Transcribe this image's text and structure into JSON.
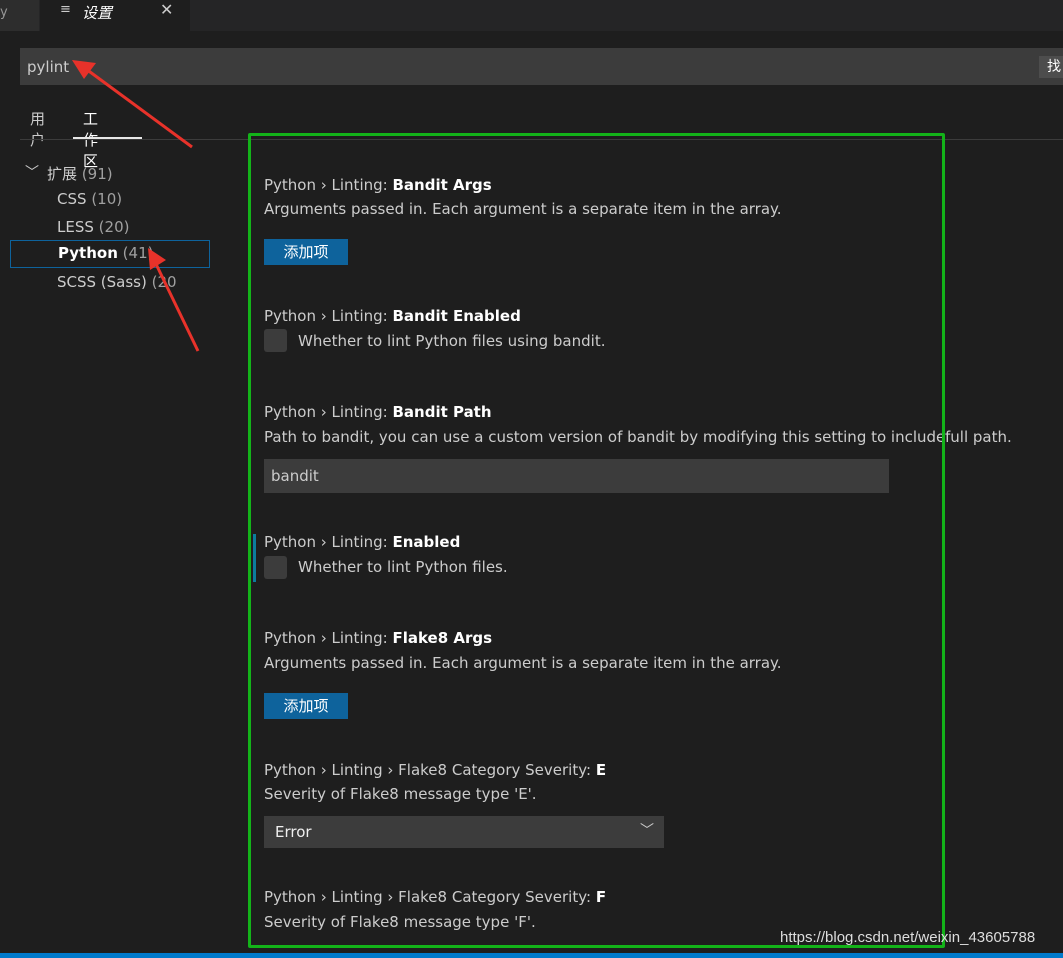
{
  "tabs": {
    "prev_label": "y",
    "active_icon": "settings-file-icon",
    "active_title": "设置",
    "close_glyph": "✕"
  },
  "search": {
    "value": "pylint",
    "badge": "找"
  },
  "scope_tabs": {
    "user": "用户",
    "workspace": "工作区"
  },
  "toc": {
    "group_label": "扩展",
    "group_count": "(91)",
    "items": [
      {
        "label": "CSS",
        "count": "(10)"
      },
      {
        "label": "LESS",
        "count": "(20)"
      },
      {
        "label": "Python",
        "count": "(41)"
      },
      {
        "label": "SCSS (Sass)",
        "count": "(20"
      }
    ]
  },
  "settings": [
    {
      "prefix": "Python › Linting: ",
      "name": "Bandit Args",
      "desc": "Arguments passed in. Each argument is a separate item in the array.",
      "button": "添加项"
    },
    {
      "prefix": "Python › Linting: ",
      "name": "Bandit Enabled",
      "desc": "Whether to lint Python files using bandit."
    },
    {
      "prefix": "Python › Linting: ",
      "name": "Bandit Path",
      "desc": "Path to bandit, you can use a custom version of bandit by modifying this setting to include the",
      "value": "bandit"
    },
    {
      "prefix": "Python › Linting: ",
      "name": "Enabled",
      "desc": "Whether to lint Python files."
    },
    {
      "prefix": "Python › Linting: ",
      "name": "Flake8 Args",
      "desc": "Arguments passed in. Each argument is a separate item in the array.",
      "button": "添加项"
    },
    {
      "prefix": "Python › Linting › Flake8 Category Severity: ",
      "name": "E",
      "desc": "Severity of Flake8 message type 'E'.",
      "value": "Error"
    },
    {
      "prefix": "Python › Linting › Flake8 Category Severity: ",
      "name": "F",
      "desc": "Severity of Flake8 message type 'F'."
    }
  ],
  "overflow_text": "full path.",
  "watermark": "https://blog.csdn.net/weixin_43605788",
  "colors": {
    "accent_button": "#0e639c",
    "annotation_box": "#13b319",
    "annotation_arrow": "#e8322a",
    "status_bar": "#007acc"
  }
}
